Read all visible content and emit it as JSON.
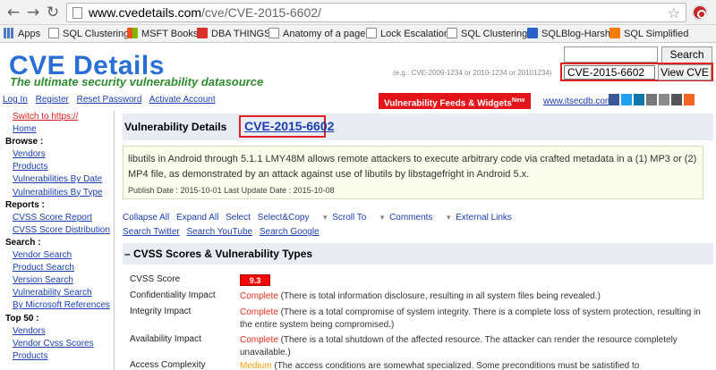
{
  "browser": {
    "url_domain": "www.cvedetails.com",
    "url_path": "/cve/CVE-2015-6602/",
    "bookmarks": [
      {
        "label": "Apps",
        "icon": "apps-icon"
      },
      {
        "label": "SQL Clustering",
        "icon": "page-icon"
      },
      {
        "label": "MSFT Books",
        "icon": "windows-icon"
      },
      {
        "label": "DBA THINGS",
        "icon": "red-icon"
      },
      {
        "label": "Anatomy of a page",
        "icon": "page-icon"
      },
      {
        "label": "Lock Escalation",
        "icon": "page-icon"
      },
      {
        "label": "SQL Clustering",
        "icon": "page-icon"
      },
      {
        "label": "SQLBlog-Harsh",
        "icon": "blue-icon"
      },
      {
        "label": "SQL Simplified",
        "icon": "blogger-icon"
      }
    ]
  },
  "header": {
    "title": "CVE Details",
    "tagline": "The ultimate security vulnerability datasource",
    "search_button": "Search",
    "example_hint": "(e.g.: CVE-2009-1234 or 2010-1234 or 20101234)",
    "cve_input_value": "CVE-2015-6602",
    "view_button": "View CVE",
    "user_links": [
      "Log In",
      "Register",
      "Reset Password",
      "Activate Account"
    ],
    "feeds_label": "Vulnerability Feeds & Widgets",
    "feeds_badge": "New",
    "itsecdb": "www.itsecdb.com"
  },
  "sidebar": {
    "https": "Switch to https://",
    "home": "Home",
    "browse_head": "Browse :",
    "browse": [
      "Vendors",
      "Products",
      "Vulnerabilities By Date",
      "Vulnerabilities By Type"
    ],
    "reports_head": "Reports :",
    "reports": [
      "CVSS Score Report",
      "CVSS Score Distribution"
    ],
    "search_head": "Search :",
    "search": [
      "Vendor Search",
      "Product Search",
      "Version Search",
      "Vulnerability Search",
      "By Microsoft References"
    ],
    "top_head": "Top 50 :",
    "top": [
      "Vendors",
      "Vendor Cvss Scores",
      "Products"
    ]
  },
  "main": {
    "vd_title": "Vulnerability Details",
    "cve_id": "CVE-2015-6602",
    "description": "libutils in Android through 5.1.1 LMY48M allows remote attackers to execute arbitrary code via crafted metadata in a (1) MP3 or (2) MP4 file, as demonstrated by an attack against use of libutils by libstagefright in Android 5.x.",
    "dates": "Publish Date : 2015-10-01 Last Update Date : 2015-10-08",
    "actions": {
      "collapse_all": "Collapse All",
      "expand_all": "Expand All",
      "select": "Select",
      "select_copy": "Select&Copy",
      "scroll_to": "Scroll To",
      "comments": "Comments",
      "external_links": "External Links",
      "search_twitter": "Search Twitter",
      "search_youtube": "Search YouTube",
      "search_google": "Search Google"
    },
    "cvss_header": "– CVSS Scores & Vulnerability Types",
    "cvss_score_label": "CVSS Score",
    "cvss_score": "9.3",
    "rows": [
      {
        "label": "Confidentiality Impact",
        "level": "Complete",
        "text": " (There is total information disclosure, resulting in all system files being revealed.)"
      },
      {
        "label": "Integrity Impact",
        "level": "Complete",
        "text": " (There is a total compromise of system integrity. There is a complete loss of system protection, resulting in the entire system being compromised.)"
      },
      {
        "label": "Availability Impact",
        "level": "Complete",
        "text": " (There is a total shutdown of the affected resource. The attacker can render the resource completely unavailable.)"
      },
      {
        "label": "Access Complexity",
        "level": "Medium",
        "text": " (The access conditions are somewhat specialized. Some preconditions must be satistified to"
      }
    ]
  },
  "colors": {
    "brand_blue": "#2a6fd6",
    "tagline_green": "#2e8b2e",
    "highlight_red": "#e02020",
    "complete_red": "#e03020",
    "medium_orange": "#f0a000"
  }
}
